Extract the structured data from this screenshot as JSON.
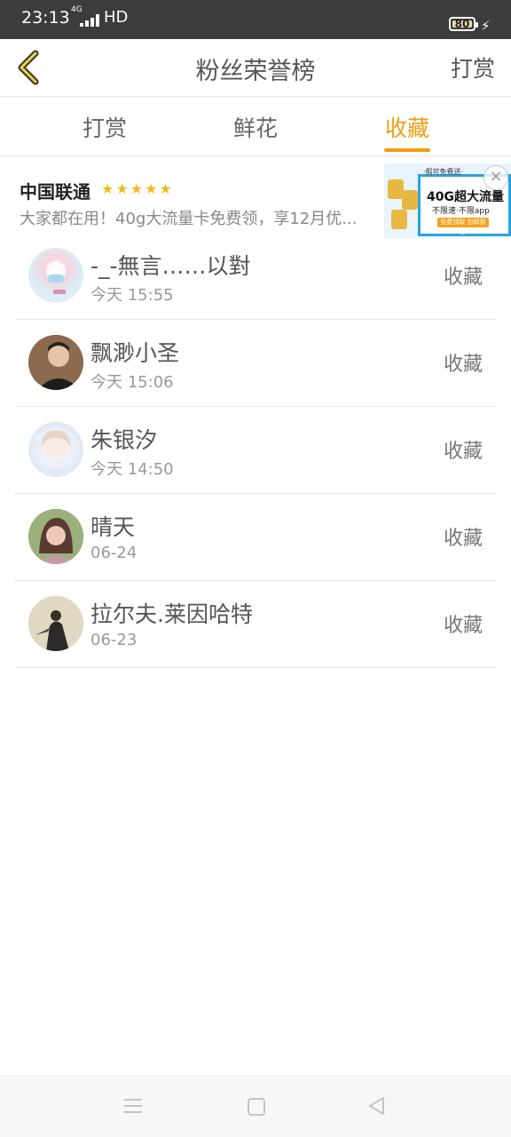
{
  "status_bar": {
    "time": "23:13",
    "network": "4G",
    "signal_label": "HD",
    "battery": "80"
  },
  "header": {
    "title": "粉丝荣誉榜",
    "right_action": "打赏"
  },
  "tabs": [
    {
      "label": "打赏",
      "active": false
    },
    {
      "label": "鲜花",
      "active": false
    },
    {
      "label": "收藏",
      "active": true
    }
  ],
  "ad": {
    "advertiser": "中国联通",
    "rating": "★★★★★",
    "description": "大家都在用！40g大流量卡免费领，享12月优...",
    "image_text": {
      "top": "·假可免费送·",
      "headline": "40G超大流量",
      "sub": "不限速·不限app",
      "button": "免费领取 包邮到家"
    }
  },
  "list": [
    {
      "name": "-_-無言……以對",
      "time": "今天 15:55",
      "action": "收藏"
    },
    {
      "name": "飘渺小圣",
      "time": "今天 15:06",
      "action": "收藏"
    },
    {
      "name": "朱银汐",
      "time": "今天 14:50",
      "action": "收藏"
    },
    {
      "name": "晴天",
      "time": "06-24",
      "action": "收藏"
    },
    {
      "name": "拉尔夫.莱因哈特",
      "time": "06-23",
      "action": "收藏"
    }
  ],
  "colors": {
    "accent": "#f29c11",
    "status_bar": "#3c3c3c",
    "star": "#f5b91c"
  }
}
